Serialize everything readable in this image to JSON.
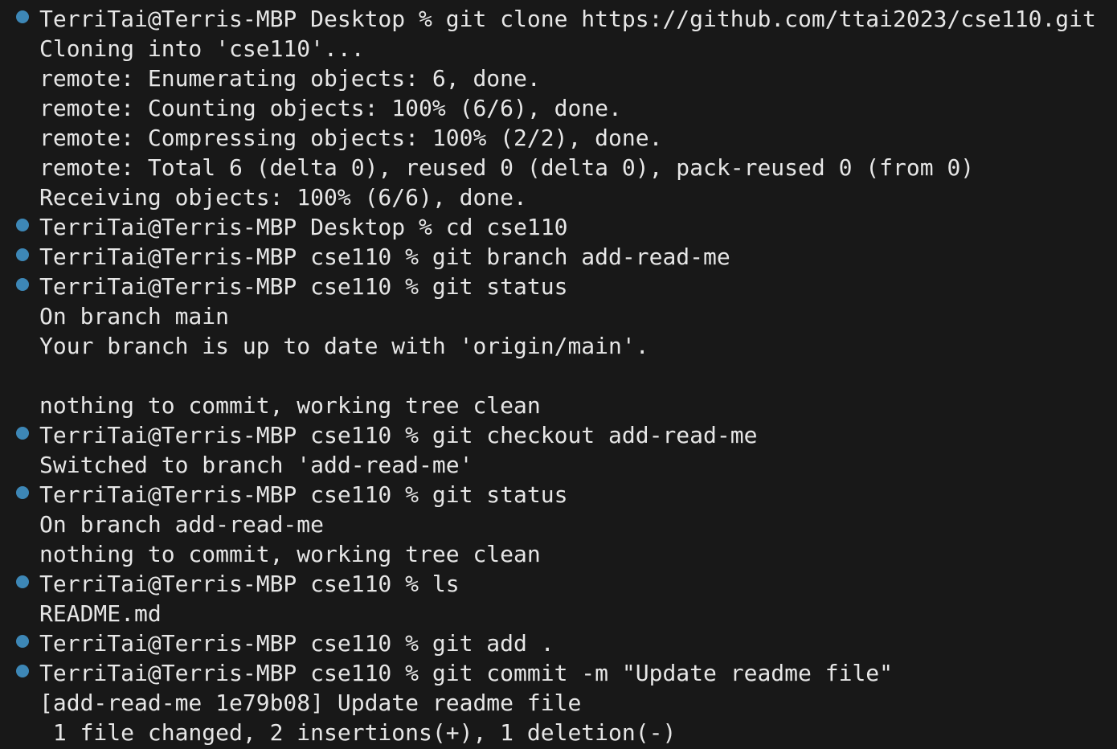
{
  "terminal": {
    "lines": [
      {
        "text": "TerriTai@Terris-MBP Desktop % git clone https://github.com/ttai2023/cse110.git",
        "prompt": true
      },
      {
        "text": "Cloning into 'cse110'...",
        "prompt": false
      },
      {
        "text": "remote: Enumerating objects: 6, done.",
        "prompt": false
      },
      {
        "text": "remote: Counting objects: 100% (6/6), done.",
        "prompt": false
      },
      {
        "text": "remote: Compressing objects: 100% (2/2), done.",
        "prompt": false
      },
      {
        "text": "remote: Total 6 (delta 0), reused 0 (delta 0), pack-reused 0 (from 0)",
        "prompt": false
      },
      {
        "text": "Receiving objects: 100% (6/6), done.",
        "prompt": false
      },
      {
        "text": "TerriTai@Terris-MBP Desktop % cd cse110",
        "prompt": true
      },
      {
        "text": "TerriTai@Terris-MBP cse110 % git branch add-read-me",
        "prompt": true
      },
      {
        "text": "TerriTai@Terris-MBP cse110 % git status",
        "prompt": true
      },
      {
        "text": "On branch main",
        "prompt": false
      },
      {
        "text": "Your branch is up to date with 'origin/main'.",
        "prompt": false
      },
      {
        "text": "",
        "prompt": false
      },
      {
        "text": "nothing to commit, working tree clean",
        "prompt": false
      },
      {
        "text": "TerriTai@Terris-MBP cse110 % git checkout add-read-me",
        "prompt": true
      },
      {
        "text": "Switched to branch 'add-read-me'",
        "prompt": false
      },
      {
        "text": "TerriTai@Terris-MBP cse110 % git status",
        "prompt": true
      },
      {
        "text": "On branch add-read-me",
        "prompt": false
      },
      {
        "text": "nothing to commit, working tree clean",
        "prompt": false
      },
      {
        "text": "TerriTai@Terris-MBP cse110 % ls",
        "prompt": true
      },
      {
        "text": "README.md",
        "prompt": false
      },
      {
        "text": "TerriTai@Terris-MBP cse110 % git add .",
        "prompt": true
      },
      {
        "text": "TerriTai@Terris-MBP cse110 % git commit -m \"Update readme file\"",
        "prompt": true
      },
      {
        "text": "[add-read-me 1e79b08] Update readme file",
        "prompt": false
      },
      {
        "text": " 1 file changed, 2 insertions(+), 1 deletion(-)",
        "prompt": false
      }
    ],
    "colors": {
      "background": "#181818",
      "text": "#e6e6e6",
      "command_marker": "#3d87b6"
    }
  }
}
